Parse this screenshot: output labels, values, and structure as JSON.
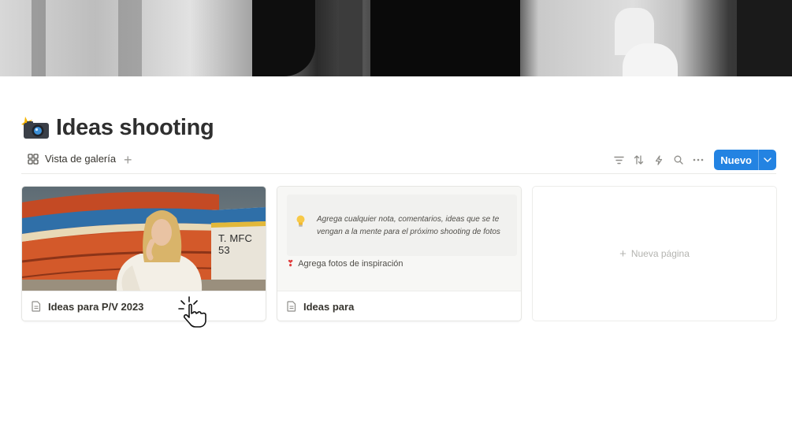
{
  "page": {
    "title": "Ideas shooting",
    "icon": "camera-with-flash-icon"
  },
  "view": {
    "tab_label": "Vista de galería",
    "add_view": "+",
    "new_button": "Nuevo",
    "accent": "#2383e2"
  },
  "toolbar": {
    "icons": [
      "filter-icon",
      "sort-icon",
      "automation-icon",
      "search-icon",
      "more-icon"
    ]
  },
  "cards": [
    {
      "title": "Ideas para P/V 2023",
      "cover": "photo-woman-with-boat",
      "boat_text": "T. MFC 53"
    },
    {
      "title": "Ideas para",
      "callout_text": "Agrega cualquier nota, comentarios, ideas que se te vengan a la mente para el próximo shooting de fotos",
      "pin_text": "Agrega fotos de inspiración"
    }
  ],
  "new_page": {
    "plus": "+",
    "label": "Nueva página"
  }
}
